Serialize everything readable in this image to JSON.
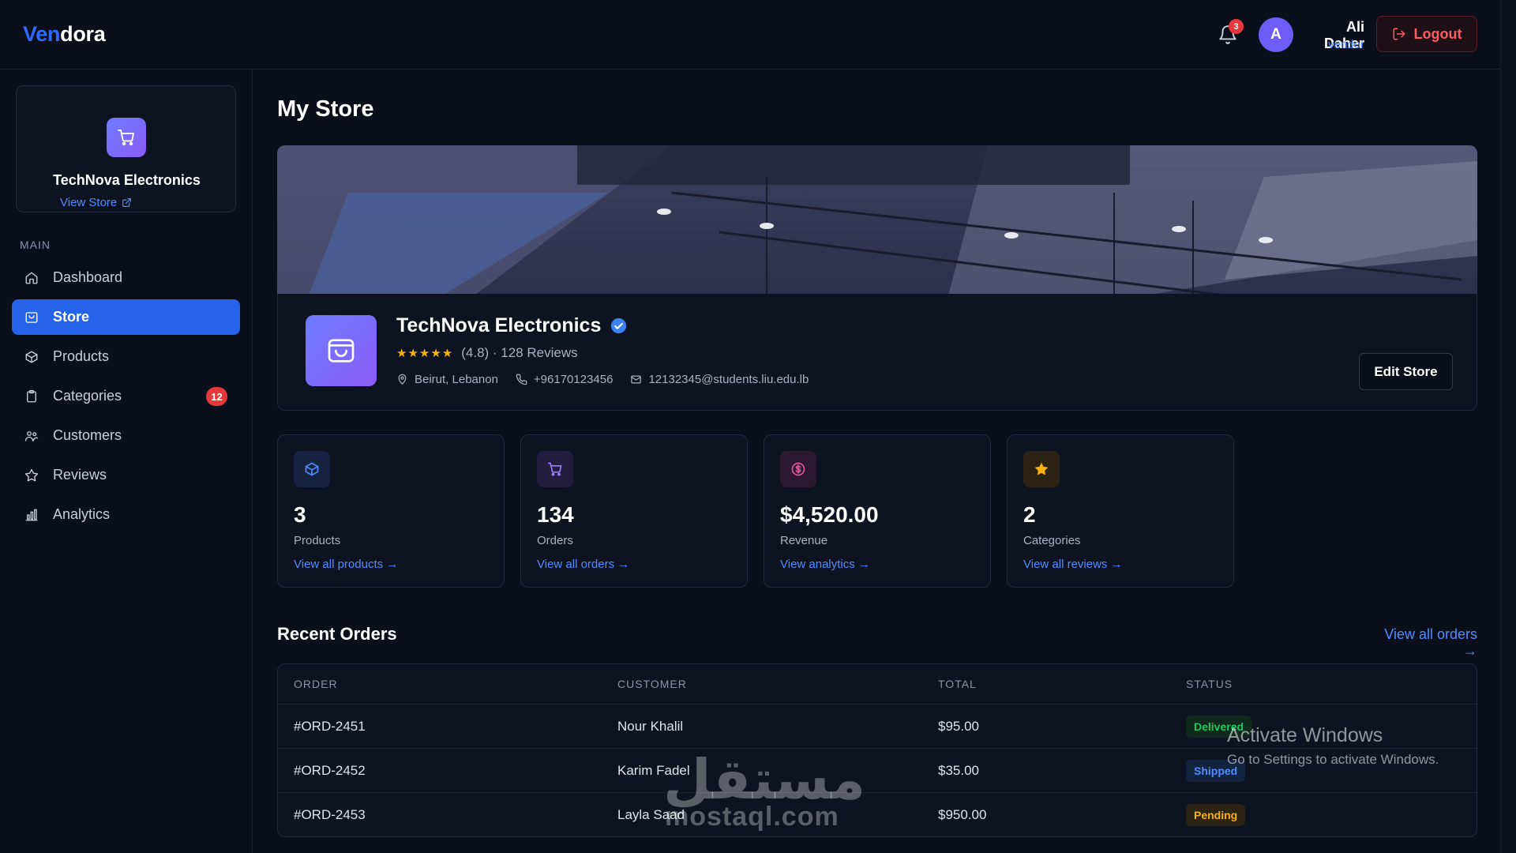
{
  "brand": {
    "part1": "Ven",
    "part2": "dora"
  },
  "header": {
    "notifications_count": "3",
    "avatar_initial": "A",
    "user_name": "Ali Daher",
    "user_role": "vendor",
    "logout_label": "Logout"
  },
  "sidebar": {
    "store_name": "TechNova Electronics",
    "view_store_label": "View Store",
    "section_label": "MAIN",
    "items": [
      {
        "label": "Dashboard",
        "icon": "home-icon"
      },
      {
        "label": "Store",
        "icon": "store-icon",
        "active": true
      },
      {
        "label": "Products",
        "icon": "box-icon"
      },
      {
        "label": "Categories",
        "icon": "clipboard-icon",
        "badge": "12"
      },
      {
        "label": "Customers",
        "icon": "users-icon"
      },
      {
        "label": "Reviews",
        "icon": "star-icon"
      },
      {
        "label": "Analytics",
        "icon": "chart-icon"
      }
    ]
  },
  "main": {
    "title": "My Store",
    "store": {
      "name": "TechNova Electronics",
      "stars": "★★★★★",
      "rating_text": "(4.8) · 128 Reviews",
      "location": "Beirut, Lebanon",
      "phone": "+96170123456",
      "email": "12132345@students.liu.edu.lb",
      "edit_label": "Edit Store"
    },
    "stats": [
      {
        "value": "3",
        "label": "Products",
        "link": "View all products →",
        "icon": "cube-icon",
        "color": "#4f8dff",
        "bg": "#16223f"
      },
      {
        "value": "134",
        "label": "Orders",
        "link": "View all orders →",
        "icon": "cart-icon",
        "color": "#9b7bff",
        "bg": "#221c3f"
      },
      {
        "value": "$4,520.00",
        "label": "Revenue",
        "link": "View analytics →",
        "icon": "dollar-icon",
        "color": "#e0569b",
        "bg": "#2c1830"
      },
      {
        "value": "2",
        "label": "Categories",
        "link": "View all reviews →",
        "icon": "star-icon",
        "color": "#f6b20a",
        "bg": "#2b2414"
      }
    ],
    "recent_orders": {
      "title": "Recent Orders",
      "view_all": "View all orders →",
      "columns": [
        "ORDER",
        "CUSTOMER",
        "TOTAL",
        "STATUS"
      ],
      "rows": [
        {
          "order": "#ORD-2451",
          "customer": "Nour Khalil",
          "total": "$95.00",
          "status": "Delivered",
          "status_color": "#22c55e",
          "status_bg": "#0f2a1c"
        },
        {
          "order": "#ORD-2452",
          "customer": "Karim Fadel",
          "total": "$35.00",
          "status": "Shipped",
          "status_color": "#4f8dff",
          "status_bg": "#13233f"
        },
        {
          "order": "#ORD-2453",
          "customer": "Layla Saad",
          "total": "$950.00",
          "status": "Pending",
          "status_color": "#f6b20a",
          "status_bg": "#2b2414"
        }
      ]
    }
  },
  "overlays": {
    "watermark": "مستقل",
    "watermark_sub": "mostaql.com",
    "activate_title": "Activate Windows",
    "activate_sub": "Go to Settings to activate Windows."
  }
}
